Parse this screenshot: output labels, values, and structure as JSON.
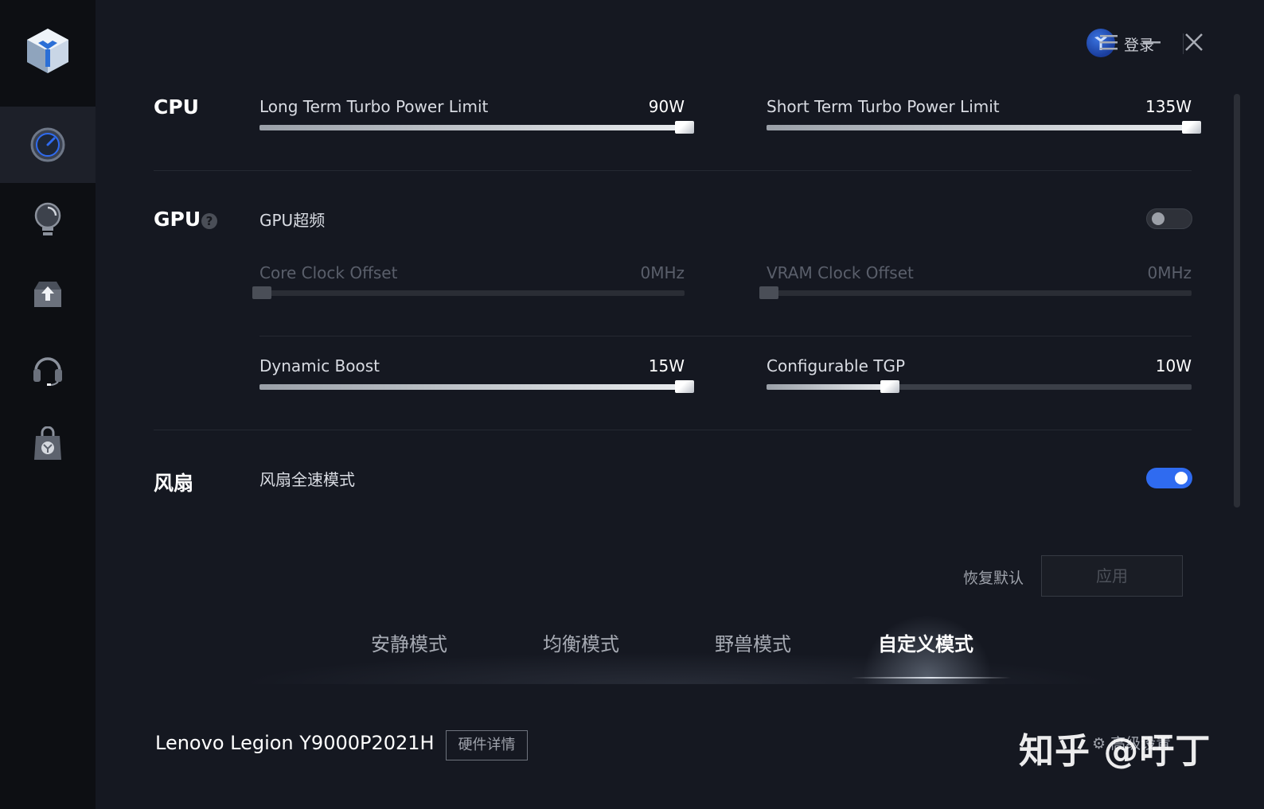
{
  "topbar": {
    "login_label": "登录"
  },
  "sidebar": {
    "items": [
      {
        "icon": "speedometer-icon",
        "active": true
      },
      {
        "icon": "lightbulb-icon",
        "active": false
      },
      {
        "icon": "upload-icon",
        "active": false
      },
      {
        "icon": "headset-icon",
        "active": false
      },
      {
        "icon": "shopping-bag-icon",
        "active": false
      }
    ]
  },
  "cpu": {
    "title": "CPU",
    "long_term": {
      "label": "Long Term Turbo Power Limit",
      "value": "90W",
      "fill": 1.0
    },
    "short_term": {
      "label": "Short Term Turbo Power Limit",
      "value": "135W",
      "fill": 1.0
    }
  },
  "gpu": {
    "title": "GPU",
    "help_glyph": "?",
    "overclock_label": "GPU超频",
    "overclock_on": false,
    "core_clock": {
      "label": "Core Clock Offset",
      "value": "0MHz",
      "fill": 0.0
    },
    "vram_clock": {
      "label": "VRAM Clock Offset",
      "value": "0MHz",
      "fill": 0.0
    },
    "dynamic_boost": {
      "label": "Dynamic Boost",
      "value": "15W",
      "fill": 1.0
    },
    "configurable_tgp": {
      "label": "Configurable TGP",
      "value": "10W",
      "fill": 0.29
    }
  },
  "fan": {
    "title": "风扇",
    "fullspeed_label": "风扇全速模式",
    "fullspeed_on": true
  },
  "actions": {
    "restore_label": "恢复默认",
    "apply_label": "应用"
  },
  "modes": {
    "tabs": [
      "安静模式",
      "均衡模式",
      "野兽模式",
      "自定义模式"
    ],
    "active_index": 3
  },
  "footer": {
    "device_name": "Lenovo Legion Y9000P2021H",
    "hw_details_label": "硬件详情",
    "settings_label": "⚙ 高级设置",
    "watermark": "知乎 @吁丁"
  },
  "colors": {
    "accent": "#2f6bf0",
    "background": "#151821",
    "sidebar": "#0d0f13"
  }
}
